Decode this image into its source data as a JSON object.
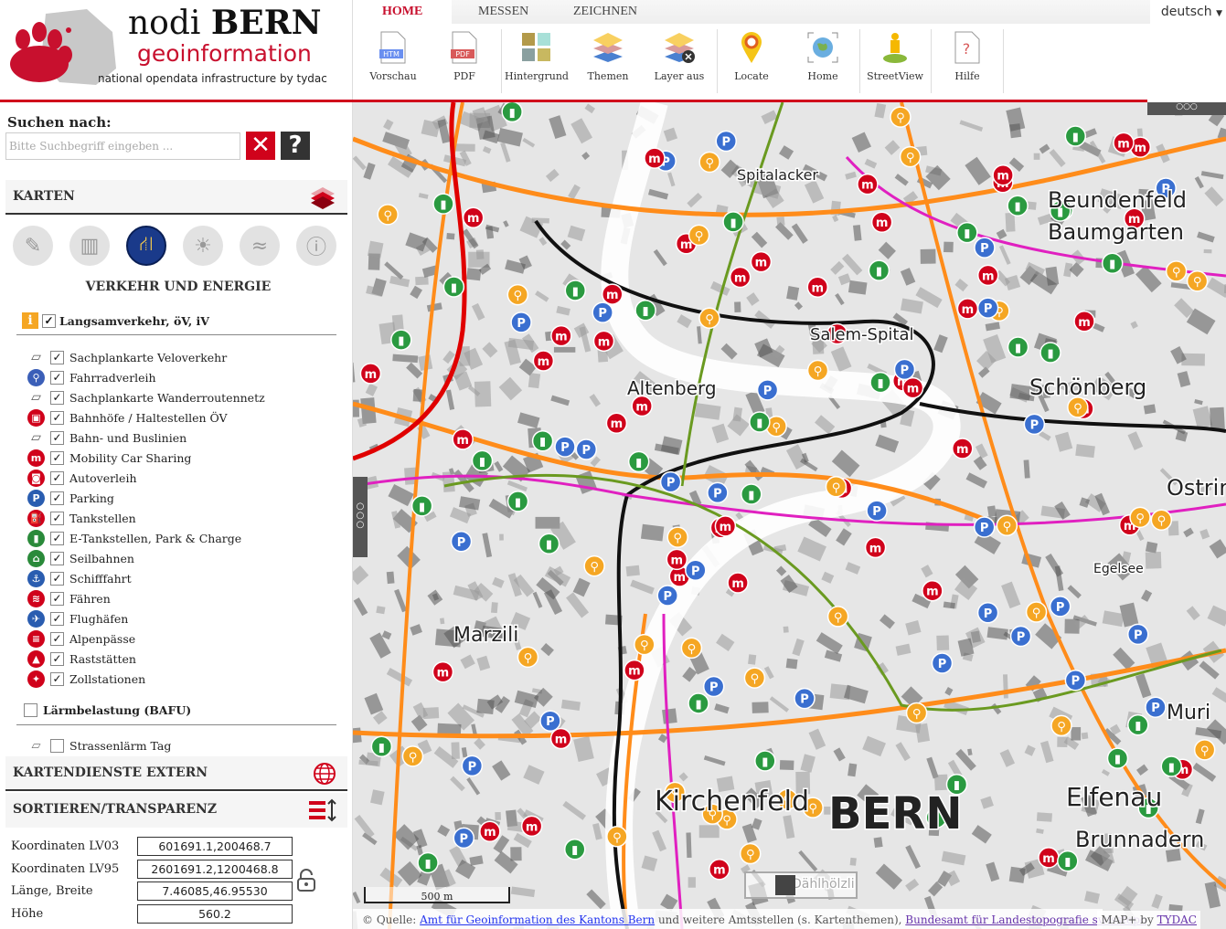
{
  "logo": {
    "title_light": "nodi",
    "title_bold": "BERN",
    "subtitle": "geoinformation",
    "tagline": "national opendata infrastructure by tydac"
  },
  "search": {
    "label": "Suchen nach:",
    "value": "",
    "placeholder": "Bitte Suchbegriff eingeben ...",
    "clear_icon": "x-icon",
    "help_label": "?"
  },
  "sections": {
    "karten": "KARTEN",
    "extern": "KARTENDIENSTE EXTERN",
    "sortieren": "SORTIEREN/TRANSPARENZ"
  },
  "theme": {
    "title": "VERKEHR UND ENERGIE",
    "categories": [
      "planning",
      "settlement",
      "traffic-energy",
      "environment",
      "topography",
      "information"
    ],
    "active_category": "traffic-energy"
  },
  "group": {
    "label": "Langsamverkehr, öV, iV",
    "checked": true
  },
  "layers": [
    {
      "label": "Sachplankarte Veloverkehr",
      "icon": "stack",
      "color": "#777",
      "checked": true
    },
    {
      "label": "Fahrradverleih",
      "icon": "bike",
      "color": "#3b5fb8",
      "checked": true
    },
    {
      "label": "Sachplankarte Wanderroutennetz",
      "icon": "stack",
      "color": "#777",
      "checked": true
    },
    {
      "label": "Bahnhöfe / Haltestellen ÖV",
      "icon": "train",
      "color": "#d0021b",
      "checked": true
    },
    {
      "label": "Bahn- und Buslinien",
      "icon": "stack",
      "color": "#777",
      "checked": true
    },
    {
      "label": "Mobility Car Sharing",
      "icon": "m",
      "color": "#d0021b",
      "checked": true
    },
    {
      "label": "Autoverleih",
      "icon": "car",
      "color": "#d0021b",
      "checked": true
    },
    {
      "label": "Parking",
      "icon": "P",
      "color": "#2a5db0",
      "checked": true
    },
    {
      "label": "Tankstellen",
      "icon": "fuel",
      "color": "#d0021b",
      "checked": true
    },
    {
      "label": "E-Tankstellen, Park & Charge",
      "icon": "plug",
      "color": "#2a8a3a",
      "checked": true
    },
    {
      "label": "Seilbahnen",
      "icon": "cable",
      "color": "#2a8a3a",
      "checked": true
    },
    {
      "label": "Schifffahrt",
      "icon": "anchor",
      "color": "#2a5db0",
      "checked": true
    },
    {
      "label": "Fähren",
      "icon": "ferry",
      "color": "#d0021b",
      "checked": true
    },
    {
      "label": "Flughäfen",
      "icon": "plane",
      "color": "#2a5db0",
      "checked": true
    },
    {
      "label": "Alpenpässe",
      "icon": "pass",
      "color": "#d0021b",
      "checked": true
    },
    {
      "label": "Raststätten",
      "icon": "rest",
      "color": "#d0021b",
      "checked": true
    },
    {
      "label": "Zollstationen",
      "icon": "customs",
      "color": "#d0021b",
      "checked": true
    }
  ],
  "group2": {
    "label": "Lärmbelastung (BAFU)",
    "checked": false
  },
  "layer2": {
    "label": "Strassenlärm Tag",
    "checked": false
  },
  "coords": [
    {
      "label": "Koordinaten LV03",
      "value": "601691.1,200468.7"
    },
    {
      "label": "Koordinaten LV95",
      "value": "2601691.2,1200468.8"
    },
    {
      "label": "Länge, Breite",
      "value": "7.46085,46.95530"
    },
    {
      "label": "Höhe",
      "value": "560.2"
    }
  ],
  "toolbar": {
    "tabs": [
      "HOME",
      "MESSEN",
      "ZEICHNEN"
    ],
    "active_tab": "HOME",
    "language": "deutsch",
    "tools": [
      {
        "label": "Vorschau",
        "icon": "htm-file-icon",
        "badge": "HTM"
      },
      {
        "label": "PDF",
        "icon": "pdf-file-icon",
        "badge": "PDF"
      },
      {
        "label": "Hintergrund",
        "icon": "background-icon"
      },
      {
        "label": "Themen",
        "icon": "layers-icon"
      },
      {
        "label": "Layer aus",
        "icon": "layers-off-icon"
      },
      {
        "label": "Locate",
        "icon": "location-pin-icon"
      },
      {
        "label": "Home",
        "icon": "globe-icon"
      },
      {
        "label": "StreetView",
        "icon": "pegman-icon"
      },
      {
        "label": "Hilfe",
        "icon": "help-file-icon"
      }
    ]
  },
  "map": {
    "labels": [
      "BERN",
      "Kirchenfeld",
      "Schönberg",
      "Elfenau",
      "Brunnadern",
      "Beundenfeld",
      "Baumgarten",
      "Altenberg",
      "Salem-Spital",
      "Marzili",
      "Ostring",
      "Muri",
      "Dählhölzli",
      "Spitalacker",
      "Egelsee"
    ],
    "scale": "500 m",
    "attribution": {
      "prefix": "© Quelle:",
      "link1": "Amt für Geoinformation des Kantons Bern",
      "middle": "und weitere Amtsstellen (s. Kartenthemen),",
      "link2": "Bundesamt für Landestopografie swisstopo"
    },
    "credit_prefix": "MAP+ by",
    "credit_link": "TYDAC"
  }
}
